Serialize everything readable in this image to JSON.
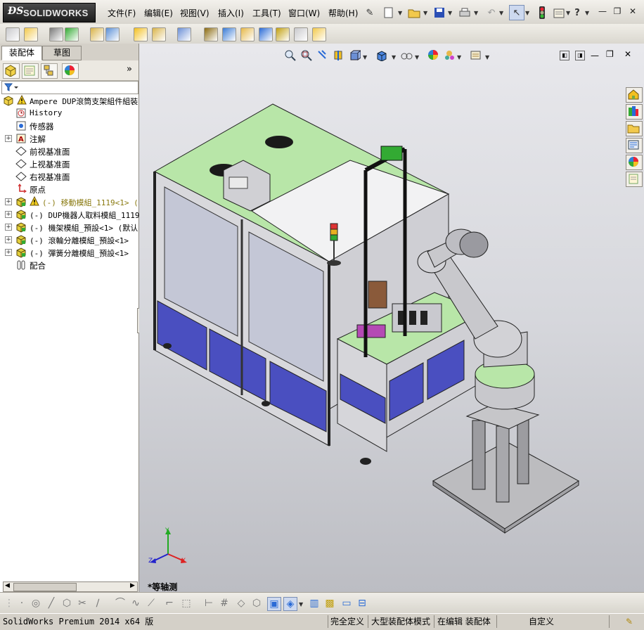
{
  "app": {
    "brand": "SOLIDWORKS"
  },
  "menu": [
    "文件(F)",
    "编辑(E)",
    "视图(V)",
    "插入(I)",
    "工具(T)",
    "窗口(W)",
    "帮助(H)"
  ],
  "panel": {
    "tabs": [
      "装配体",
      "草图"
    ],
    "tree": [
      {
        "label": "Ampere DUP滾筒支架組件組裝",
        "warning": true,
        "expand": "",
        "kind": "assembly",
        "mono": true
      },
      {
        "label": "History",
        "expand": "",
        "kind": "history",
        "mono": true
      },
      {
        "label": "传感器",
        "expand": "",
        "kind": "sensor"
      },
      {
        "label": "注解",
        "expand": "+",
        "kind": "annotation"
      },
      {
        "label": "前视基准面",
        "expand": "",
        "kind": "plane"
      },
      {
        "label": "上视基准面",
        "expand": "",
        "kind": "plane"
      },
      {
        "label": "右视基准面",
        "expand": "",
        "kind": "plane"
      },
      {
        "label": "原点",
        "expand": "",
        "kind": "origin"
      },
      {
        "label": "(-) 移動模組_1119<1> (",
        "warning": true,
        "expand": "+",
        "kind": "subassembly",
        "mono": true,
        "olive": true
      },
      {
        "label": "(-) DUP機器人取料模組_1119",
        "expand": "+",
        "kind": "subassembly",
        "mono": true
      },
      {
        "label": "(-) 機架模組_預設<1> (默认",
        "expand": "+",
        "kind": "subassembly",
        "mono": true
      },
      {
        "label": "(-) 滾輪分離模組_預設<1>",
        "expand": "+",
        "kind": "subassembly",
        "mono": true
      },
      {
        "label": "(-) 彈簧分離模組_預設<1>",
        "expand": "+",
        "kind": "subassembly",
        "mono": true
      },
      {
        "label": "配合",
        "expand": "",
        "kind": "mates"
      }
    ]
  },
  "viewport": {
    "view_name": "*等轴测"
  },
  "axes": {
    "x": "X",
    "y": "Y",
    "z": "Z"
  },
  "status": {
    "product": "SolidWorks Premium 2014 x64 版",
    "definition": "完全定义",
    "mode": "大型装配体模式",
    "editing": "在编辑 装配体",
    "custom": "自定义"
  },
  "colors": {
    "frame_top": "#b8e6a8",
    "frame_panel": "#4a4fc0",
    "robot": "#c8c8cc",
    "viewport_bg": "#d6d7dc"
  }
}
